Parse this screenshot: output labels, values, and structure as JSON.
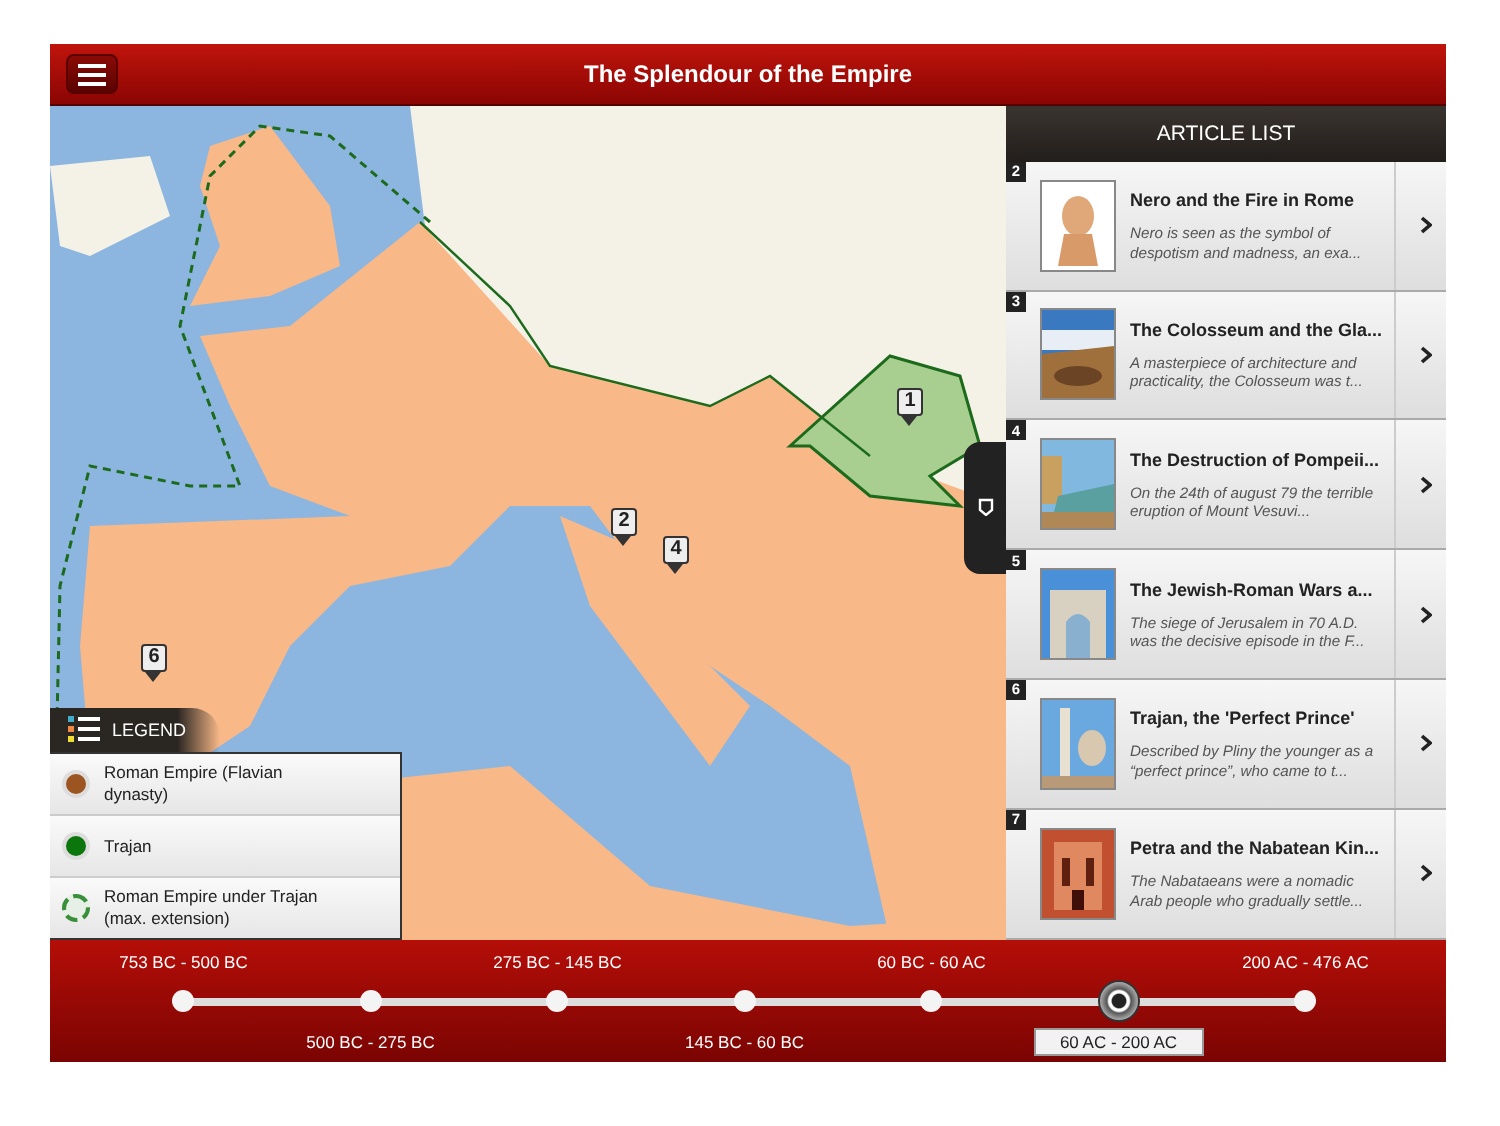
{
  "header": {
    "title": "The Splendour of the Empire"
  },
  "map": {
    "markers": [
      {
        "label": "1"
      },
      {
        "label": "2"
      },
      {
        "label": "4"
      },
      {
        "label": "6"
      }
    ]
  },
  "legend": {
    "title": "LEGEND",
    "items": [
      {
        "label": "Roman Empire (Flavian dynasty)",
        "kind": "filled",
        "color": "#9c5420"
      },
      {
        "label": "Trajan",
        "kind": "filled",
        "color": "#0b760b"
      },
      {
        "label": "Roman Empire under Trajan (max. extension)",
        "kind": "dashed",
        "color": "#3a8f3a"
      }
    ]
  },
  "article_list": {
    "title": "ARTICLE LIST",
    "items": [
      {
        "number": "2",
        "title": "Nero and the Fire in Rome",
        "description": "Nero is seen as the symbol of despotism and madness, an exa..."
      },
      {
        "number": "3",
        "title": "The Colosseum and the Gla...",
        "description": "A masterpiece of architecture and practicality, the Colosseum was t..."
      },
      {
        "number": "4",
        "title": "The Destruction of Pompeii...",
        "description": "On the 24th of august 79 the terrible eruption of Mount Vesuvi..."
      },
      {
        "number": "5",
        "title": "The Jewish-Roman Wars a...",
        "description": "The siege of Jerusalem in 70 A.D. was the decisive episode in the F..."
      },
      {
        "number": "6",
        "title": "Trajan, the 'Perfect Prince'",
        "description": "Described by Pliny the younger as a “perfect prince”, who came to t..."
      },
      {
        "number": "7",
        "title": "Petra and the Nabatean Kin...",
        "description": "The Nabataeans were a nomadic Arab people who gradually settle..."
      }
    ]
  },
  "timeline": {
    "stops": [
      {
        "label": "753 BC - 500 BC",
        "selected": false
      },
      {
        "label": "500 BC - 275 BC",
        "selected": false
      },
      {
        "label": "275 BC - 145 BC",
        "selected": false
      },
      {
        "label": "145 BC - 60 BC",
        "selected": false
      },
      {
        "label": "60 BC - 60 AC",
        "selected": false
      },
      {
        "label": "60 AC - 200 AC",
        "selected": true
      },
      {
        "label": "200 AC - 476 AC",
        "selected": false
      }
    ]
  }
}
